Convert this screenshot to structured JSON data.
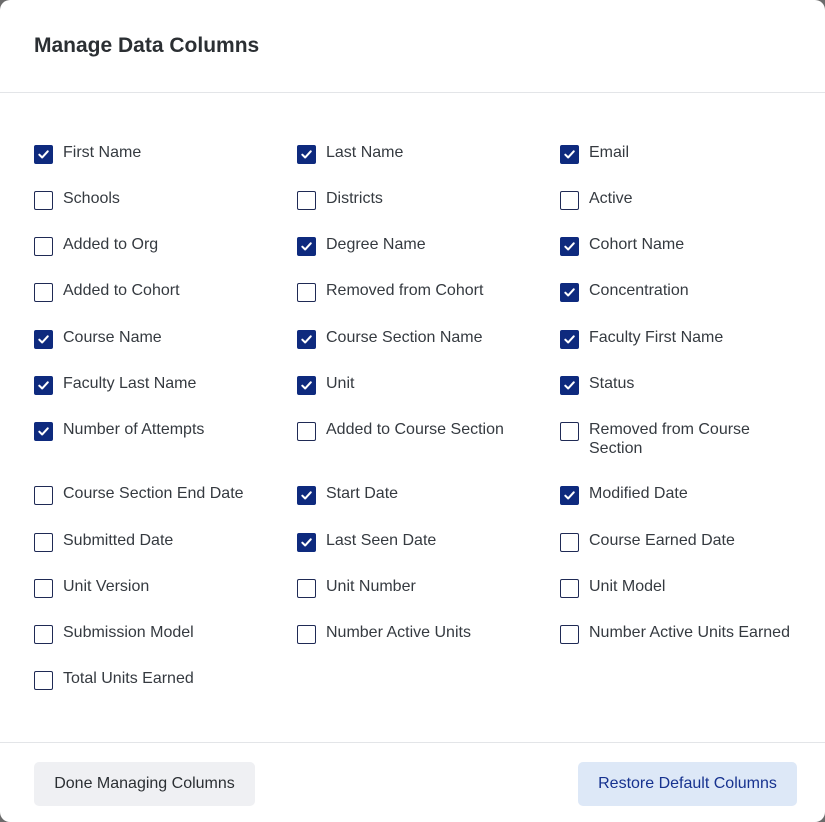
{
  "modal": {
    "title": "Manage Data Columns"
  },
  "columns": [
    [
      {
        "label": "First Name",
        "checked": true
      },
      {
        "label": "Schools",
        "checked": false
      },
      {
        "label": "Added to Org",
        "checked": false
      },
      {
        "label": "Added to Cohort",
        "checked": false
      },
      {
        "label": "Course Name",
        "checked": true
      },
      {
        "label": "Faculty Last Name",
        "checked": true
      },
      {
        "label": "Number of Attempts",
        "checked": true
      },
      {
        "label": "Course Section End Date",
        "checked": false
      },
      {
        "label": "Submitted Date",
        "checked": false
      },
      {
        "label": "Unit Version",
        "checked": false
      },
      {
        "label": "Submission Model",
        "checked": false
      },
      {
        "label": "Total Units Earned",
        "checked": false
      }
    ],
    [
      {
        "label": "Last Name",
        "checked": true
      },
      {
        "label": "Districts",
        "checked": false
      },
      {
        "label": "Degree Name",
        "checked": true
      },
      {
        "label": "Removed from Cohort",
        "checked": false
      },
      {
        "label": "Course Section Name",
        "checked": true
      },
      {
        "label": "Unit",
        "checked": true
      },
      {
        "label": "Added to Course Section",
        "checked": false
      },
      {
        "label": "Start Date",
        "checked": true
      },
      {
        "label": "Last Seen Date",
        "checked": true
      },
      {
        "label": "Unit Number",
        "checked": false
      },
      {
        "label": "Number Active Units",
        "checked": false
      }
    ],
    [
      {
        "label": "Email",
        "checked": true
      },
      {
        "label": "Active",
        "checked": false
      },
      {
        "label": "Cohort Name",
        "checked": true
      },
      {
        "label": "Concentration",
        "checked": true
      },
      {
        "label": "Faculty First Name",
        "checked": true
      },
      {
        "label": "Status",
        "checked": true
      },
      {
        "label": "Removed from Course Section",
        "checked": false
      },
      {
        "label": "Modified Date",
        "checked": true
      },
      {
        "label": "Course Earned Date",
        "checked": false
      },
      {
        "label": "Unit Model",
        "checked": false
      },
      {
        "label": "Number Active Units Earned",
        "checked": false
      }
    ]
  ],
  "footer": {
    "done_label": "Done Managing Columns",
    "restore_label": "Restore Default Columns"
  },
  "colors": {
    "checkbox_checked": "#0e2a7e",
    "primary_button_bg": "#dde8f7",
    "primary_button_text": "#16328f",
    "secondary_button_bg": "#eff0f3"
  }
}
